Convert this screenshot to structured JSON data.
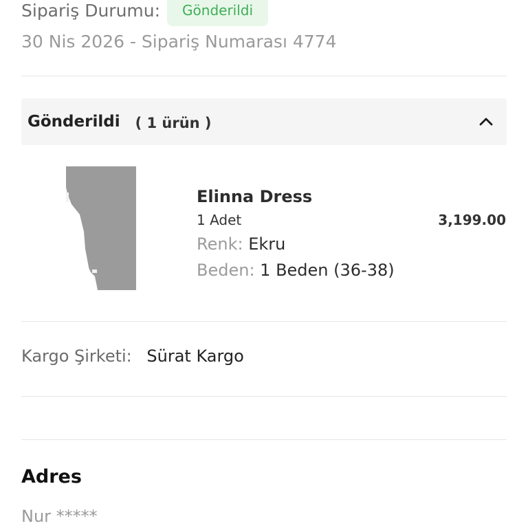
{
  "order": {
    "status_label": "Sipariş Durumu:",
    "status_value": "Gönderildi",
    "meta": "30 Nis 2026 - Sipariş Numarası 4774",
    "status_color": "#3fae56"
  },
  "shipment_group": {
    "title": "Gönderildi",
    "count": "( 1 ürün )",
    "toggle_icon": "chevron-up-icon"
  },
  "product": {
    "name": "Elinna Dress",
    "quantity": "1 Adet",
    "price": "3,199.00",
    "color_key": "Renk:",
    "color_value": "Ekru",
    "size_key": "Beden:",
    "size_value": "1 Beden (36-38)"
  },
  "cargo": {
    "label": "Kargo Şirketi:",
    "value": "Sürat Kargo"
  },
  "address": {
    "title": "Adres",
    "name": "Nur *****"
  }
}
